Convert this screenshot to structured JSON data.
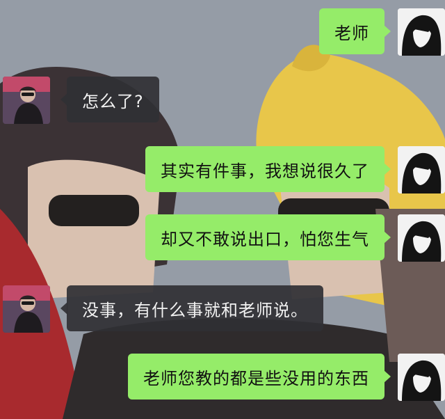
{
  "messages": [
    {
      "sender": "self",
      "text": "老师"
    },
    {
      "sender": "other",
      "text": "怎么了?"
    },
    {
      "sender": "self",
      "text": "其实有件事，我想说很久了"
    },
    {
      "sender": "self",
      "text": "却又不敢说出口，怕您生气"
    },
    {
      "sender": "other",
      "text": "没事，有什么事就和老师说。"
    },
    {
      "sender": "self",
      "text": "老师您教的都是些没用的东西"
    }
  ],
  "colors": {
    "self_bubble": "#95ec69",
    "other_bubble": "#303034",
    "self_text": "#111111",
    "other_text": "#f2f2f2"
  },
  "icons": {
    "self_avatar": "dark-haired-character-sketch-avatar",
    "other_avatar": "person-with-sunglasses-photo-avatar"
  }
}
